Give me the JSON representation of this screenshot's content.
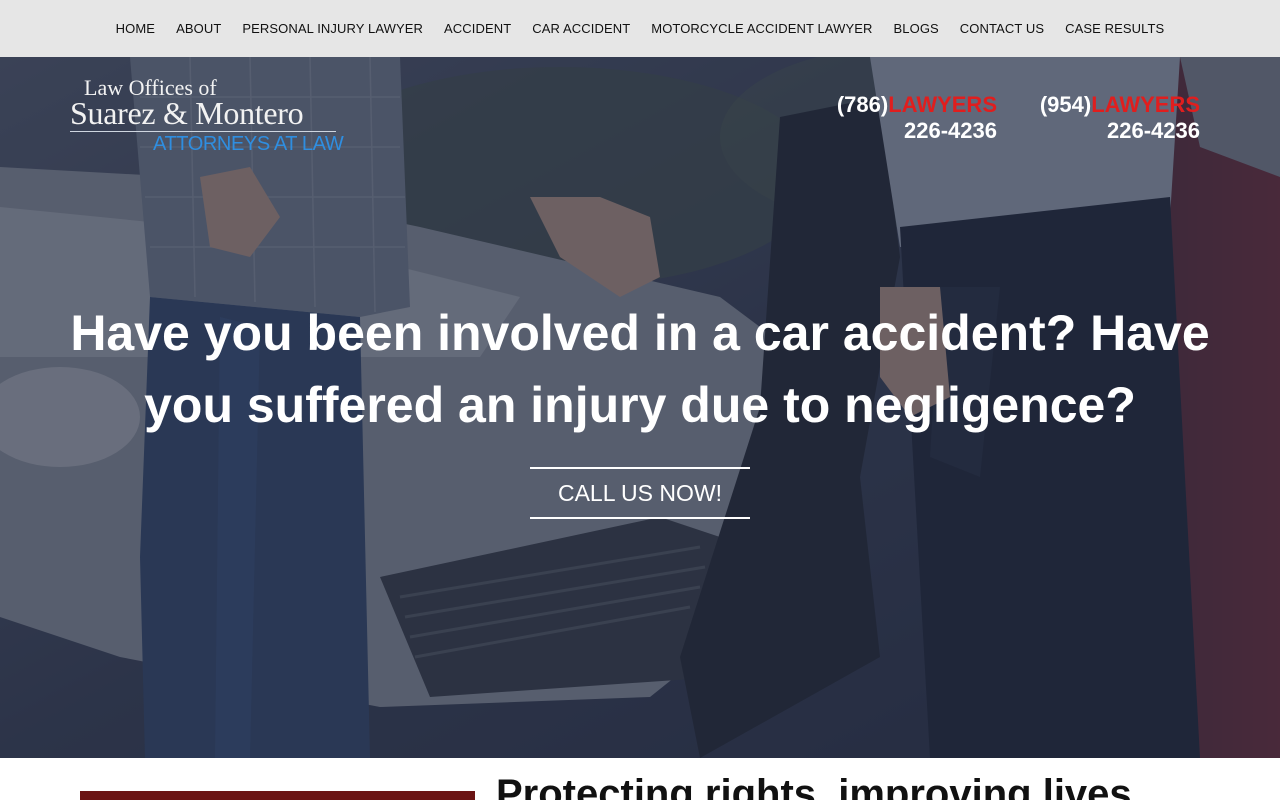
{
  "nav": {
    "items": [
      {
        "label": "HOME"
      },
      {
        "label": "ABOUT"
      },
      {
        "label": "PERSONAL INJURY LAWYER"
      },
      {
        "label": "ACCIDENT"
      },
      {
        "label": "CAR ACCIDENT"
      },
      {
        "label": "MOTORCYCLE ACCIDENT LAWYER"
      },
      {
        "label": "BLOGS"
      },
      {
        "label": "CONTACT US"
      },
      {
        "label": "CASE RESULTS"
      }
    ]
  },
  "logo": {
    "line1": "Law Offices of",
    "line2": "Suarez & Montero",
    "line3": "ATTORNEYS AT LAW"
  },
  "phones": [
    {
      "area": "(786)",
      "word": "LAWYERS",
      "number": "226-4236"
    },
    {
      "area": "(954)",
      "word": "LAWYERS",
      "number": "226-4236"
    }
  ],
  "hero": {
    "headline": "Have you been involved in a car accident? Have you suffered an injury due to negligence?",
    "cta_label": "CALL US NOW!"
  },
  "section": {
    "heading": "Protecting rights, improving lives"
  },
  "colors": {
    "nav_bg": "#e6e6e6",
    "accent_red": "#e01e1e",
    "logo_blue": "#2f8ee0",
    "section_bar": "#6b1414"
  }
}
